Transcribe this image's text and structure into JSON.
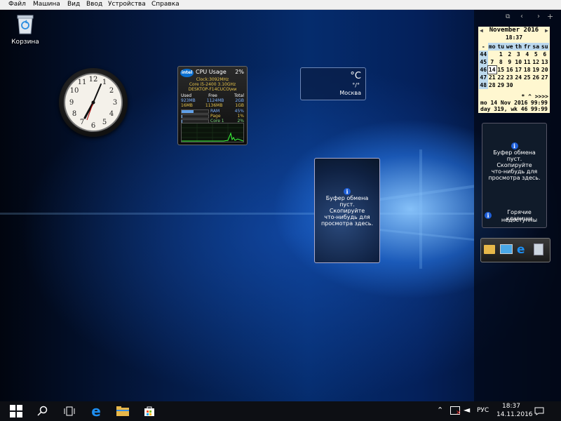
{
  "menubar": {
    "items": [
      "Файл",
      "Машина",
      "Вид",
      "Ввод",
      "Устройства",
      "Справка"
    ]
  },
  "desktop": {
    "recycle_bin_label": "Корзина"
  },
  "cpu_gadget": {
    "title": "CPU Usage",
    "percent": "2%",
    "clock": "Clock:3092MHz",
    "cpu_name": "Core i5-2400 3.10GHz",
    "host": "DESKTOP-F14CUCO\\ми",
    "headers": [
      "Used",
      "Free",
      "Total"
    ],
    "mem_rows": [
      {
        "used": "923MB",
        "free": "1124MB",
        "total": "2GB"
      },
      {
        "used": "16MB",
        "free": "1136MB",
        "total": "1GB"
      }
    ],
    "bars": [
      {
        "label": "RAM",
        "value": "45%",
        "fill": 0.45
      },
      {
        "label": "Page",
        "value": "1%",
        "fill": 0.01
      },
      {
        "label": "Core 1",
        "value": "2%",
        "fill": 0.02
      }
    ]
  },
  "weather": {
    "unit": "°C",
    "sub": "°/°",
    "city": "Москва"
  },
  "clipboard": {
    "lines": [
      "Буфер обмена",
      "пуст.",
      "Скопируйте",
      "что-нибудь для",
      "просмотра здесь."
    ],
    "hotkeys_lines": [
      "Горячие клавиши",
      "недоступны"
    ]
  },
  "calendar": {
    "month": "November 2016",
    "time": "18:37",
    "header": [
      "-",
      "mo",
      "tu",
      "we",
      "th",
      "fr",
      "sa",
      "su"
    ],
    "weeks": [
      [
        "44",
        "",
        "1",
        "2",
        "3",
        "4",
        "5",
        "6"
      ],
      [
        "45",
        "7",
        "8",
        "9",
        "10",
        "11",
        "12",
        "13"
      ],
      [
        "46",
        "14",
        "15",
        "16",
        "17",
        "18",
        "19",
        "20"
      ],
      [
        "47",
        "21",
        "22",
        "23",
        "24",
        "25",
        "26",
        "27"
      ],
      [
        "48",
        "28",
        "29",
        "30",
        "",
        "",
        "",
        ""
      ]
    ],
    "nav": "*  ^ >>>>",
    "footer1_left": "mo 14 Nov 2016",
    "footer1_right": "99:99",
    "footer2_left": "day 319, wk 46",
    "footer2_right": "99:99"
  },
  "taskbar": {
    "lang": "РУС",
    "time": "18:37",
    "date": "14.11.2016"
  },
  "colors": {
    "taskbar": "#0d0f14",
    "desktop_blue": "#0a58c8",
    "calendar_bg": "#fff7d0"
  }
}
